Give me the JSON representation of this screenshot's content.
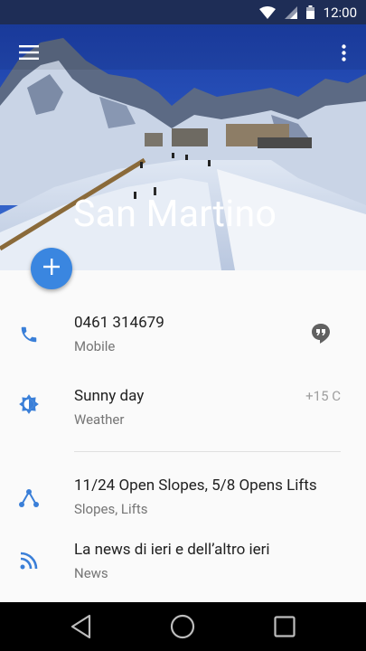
{
  "status_bar": {
    "time": "12:00",
    "icons": [
      "wifi-icon",
      "signal-icon",
      "battery-icon"
    ]
  },
  "header": {
    "title": "San Martino",
    "menu_icon": "menu-icon",
    "overflow_icon": "more-vert-icon"
  },
  "fab": {
    "icon": "add-icon"
  },
  "details": [
    {
      "icon": "phone-icon",
      "primary": "0461 314679",
      "secondary": "Mobile",
      "action_icon": "message-icon"
    },
    {
      "icon": "brightness-icon",
      "primary": "Sunny day",
      "secondary": "Weather",
      "right": "+15 C"
    },
    {
      "icon": "share-icon",
      "primary": "11/24 Open Slopes, 5/8 Opens Lifts",
      "secondary": "Slopes, Lifts"
    },
    {
      "icon": "rss-icon",
      "primary": "La news di ieri e dell’altro ieri",
      "secondary": "News"
    }
  ],
  "colors": {
    "accent": "#3a86e0",
    "status_bar": "#1e2d56",
    "icon_blue": "#3a7fd8"
  },
  "nav_bar": {
    "icons": [
      "back-icon",
      "home-icon",
      "recents-icon"
    ]
  }
}
